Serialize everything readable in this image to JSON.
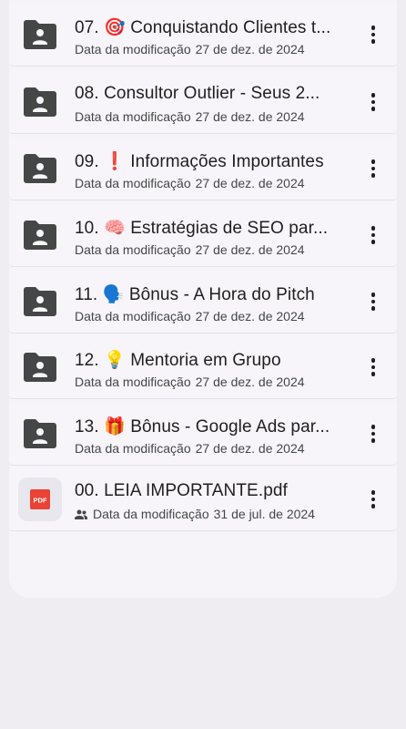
{
  "files": [
    {
      "title": "07. 🎯 Conquistando Clientes t...",
      "meta_label": "Data da modificação",
      "date": "27 de dez. de 2024",
      "icon": "shared-folder-icon"
    },
    {
      "title": "08. Consultor Outlier - Seus 2...",
      "meta_label": "Data da modificação",
      "date": "27 de dez. de 2024",
      "icon": "shared-folder-icon"
    },
    {
      "title": "09. ❗ Informações Importantes",
      "meta_label": "Data da modificação",
      "date": "27 de dez. de 2024",
      "icon": "shared-folder-icon"
    },
    {
      "title": "10. 🧠 Estratégias de SEO par...",
      "meta_label": "Data da modificação",
      "date": "27 de dez. de 2024",
      "icon": "shared-folder-icon"
    },
    {
      "title": "11. 🗣️ Bônus - A Hora do Pitch",
      "meta_label": "Data da modificação",
      "date": "27 de dez. de 2024",
      "icon": "shared-folder-icon"
    },
    {
      "title": "12. 💡 Mentoria em Grupo",
      "meta_label": "Data da modificação",
      "date": "27 de dez. de 2024",
      "icon": "shared-folder-icon"
    },
    {
      "title": "13. 🎁 Bônus - Google Ads par...",
      "meta_label": "Data da modificação",
      "date": "27 de dez. de 2024",
      "icon": "shared-folder-icon"
    },
    {
      "title": "00. LEIA IMPORTANTE.pdf",
      "meta_label": "Data da modificação",
      "date": "31 de jul. de 2024",
      "icon": "pdf-icon",
      "pdf_badge": "PDF",
      "shared": true
    }
  ],
  "colors": {
    "folder": "#444746",
    "pdf": "#ea4335",
    "background": "#efedf2"
  }
}
